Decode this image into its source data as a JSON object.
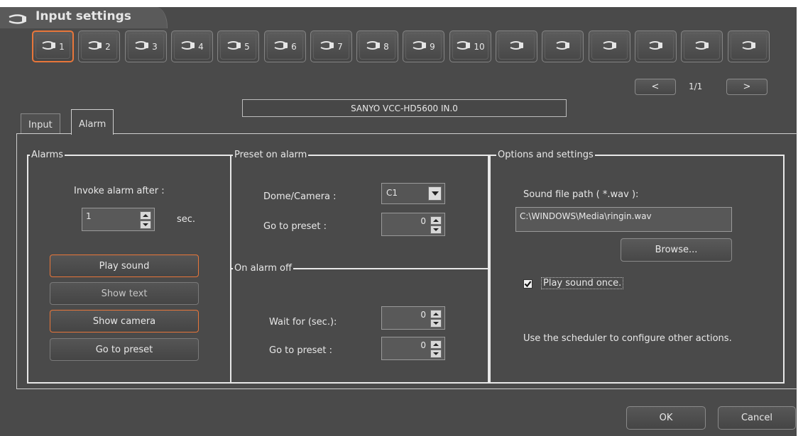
{
  "window": {
    "title": "Input settings",
    "icon": "cable-connector-icon"
  },
  "inputs": [
    {
      "label": "1",
      "active": true
    },
    {
      "label": "2"
    },
    {
      "label": "3"
    },
    {
      "label": "4"
    },
    {
      "label": "5"
    },
    {
      "label": "6"
    },
    {
      "label": "7"
    },
    {
      "label": "8"
    },
    {
      "label": "9"
    },
    {
      "label": "10"
    },
    {
      "label": ""
    },
    {
      "label": ""
    },
    {
      "label": ""
    },
    {
      "label": ""
    },
    {
      "label": ""
    },
    {
      "label": ""
    }
  ],
  "pager": {
    "prev": "<",
    "next": ">",
    "indicator": "1/1"
  },
  "camera_name": "SANYO VCC-HD5600  IN.0",
  "tabs": [
    {
      "label": "Input"
    },
    {
      "label": "Alarm",
      "active": true
    }
  ],
  "alarms": {
    "legend": "Alarms",
    "invoke_label": "Invoke alarm after :",
    "invoke_value": "1",
    "invoke_unit": "sec.",
    "buttons": [
      {
        "label": "Play sound",
        "on": true
      },
      {
        "label": "Show text",
        "on": false
      },
      {
        "label": "Show camera",
        "on": true
      },
      {
        "label": "Go to preset",
        "on": false
      }
    ]
  },
  "preset_on_alarm": {
    "legend": "Preset on alarm",
    "dome_label": "Dome/Camera :",
    "dome_value": "C1",
    "goto_label": "Go to preset :",
    "goto_value": "0"
  },
  "on_alarm_off": {
    "legend": "On alarm off",
    "wait_label": "Wait for (sec.):",
    "wait_value": "0",
    "goto_label": "Go to preset :",
    "goto_value": "0"
  },
  "options": {
    "legend": "Options and settings",
    "sound_path_label": "Sound file path ( *.wav ):",
    "sound_path_value": "C:\\WINDOWS\\Media\\ringin.wav",
    "browse_label": "Browse...",
    "play_once_label": "Play sound once.",
    "play_once_checked": true,
    "hint": "Use the scheduler to configure other actions."
  },
  "footer": {
    "ok": "OK",
    "cancel": "Cancel"
  },
  "colors": {
    "background": "#4a4a4a",
    "accent": "#e8763a",
    "text": "#e8e8e8"
  }
}
